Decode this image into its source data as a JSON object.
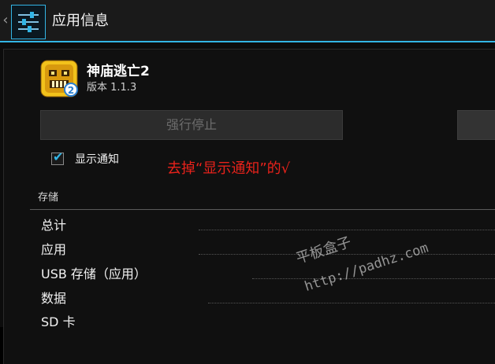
{
  "action_bar": {
    "title": "应用信息",
    "icon": "settings-sliders-icon",
    "accent": "#33b5e5"
  },
  "app": {
    "name": "神庙逃亡2",
    "version": "版本 1.1.3",
    "icon": "temple-run-2-icon"
  },
  "buttons": {
    "force_stop": "强行停止"
  },
  "notifications": {
    "label": "显示通知",
    "checked": true
  },
  "annotation": {
    "text": "去掉“显示通知”的√",
    "color": "#e8221b"
  },
  "storage": {
    "header": "存储",
    "rows": [
      {
        "label": "总计"
      },
      {
        "label": "应用"
      },
      {
        "label": "USB 存储（应用）"
      },
      {
        "label": "数据"
      },
      {
        "label": "SD 卡"
      }
    ]
  },
  "watermark": {
    "line1": "平板盒子",
    "line2": "http://padhz.com"
  }
}
